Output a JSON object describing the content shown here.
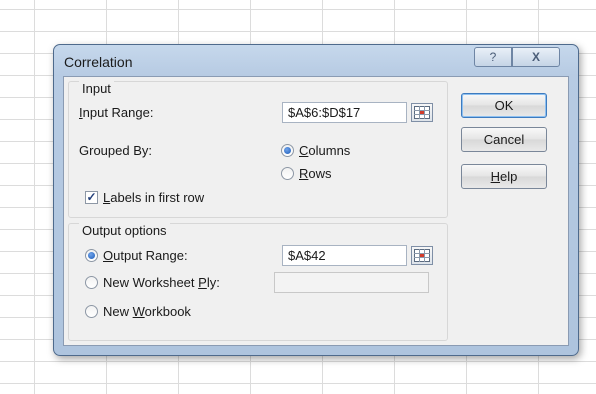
{
  "dialog": {
    "title": "Correlation",
    "help_glyph": "?",
    "close_glyph": "X"
  },
  "input": {
    "legend": "Input",
    "range_label": "Input Range:",
    "range_value": "$A$6:$D$17",
    "grouped_by_label": "Grouped By:",
    "grouped_options": [
      {
        "label": "Columns",
        "selected": true
      },
      {
        "label": "Rows",
        "selected": false
      }
    ],
    "labels_checkbox": {
      "label": "Labels in first row",
      "checked": true
    }
  },
  "output": {
    "legend": "Output options",
    "options": [
      {
        "label": "Output Range:",
        "selected": true,
        "value": "$A$42"
      },
      {
        "label": "New Worksheet Ply:",
        "selected": false,
        "value": ""
      },
      {
        "label": "New Workbook",
        "selected": false
      }
    ]
  },
  "buttons": {
    "ok": "OK",
    "cancel": "Cancel",
    "help": "Help"
  },
  "colors": {
    "frame": "#b7cbe3",
    "client": "#f0f0f0",
    "default_button_border": "#3d7bbf"
  }
}
